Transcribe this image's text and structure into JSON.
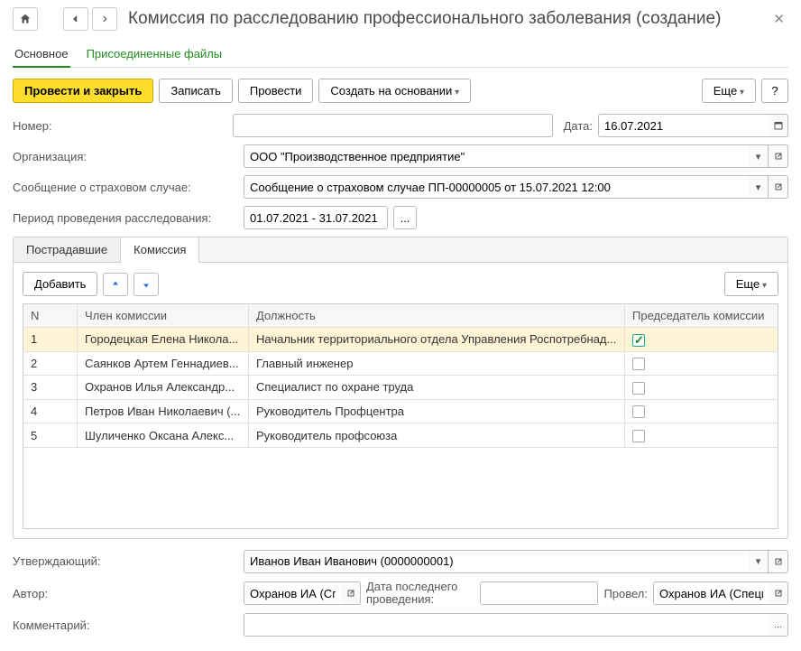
{
  "header": {
    "title": "Комиссия по расследованию профессионального заболевания (создание)"
  },
  "nav_tabs": {
    "main": "Основное",
    "attached": "Присоединенные файлы"
  },
  "toolbar": {
    "post_close": "Провести и закрыть",
    "save": "Записать",
    "post": "Провести",
    "create_based": "Создать на основании",
    "more": "Еще",
    "help": "?"
  },
  "fields": {
    "number_label": "Номер:",
    "number_value": "",
    "date_label": "Дата:",
    "date_value": "16.07.2021",
    "org_label": "Организация:",
    "org_value": "ООО \"Производственное предприятие\"",
    "case_label": "Сообщение о страховом случае:",
    "case_value": "Сообщение о страховом случае ПП-00000005 от 15.07.2021 12:00",
    "period_label": "Период проведения расследования:",
    "period_value": "01.07.2021 - 31.07.2021"
  },
  "panel": {
    "tab_victims": "Пострадавшие",
    "tab_commission": "Комиссия",
    "add": "Добавить",
    "more": "Еще",
    "col_n": "N",
    "col_member": "Член комиссии",
    "col_position": "Должность",
    "col_chair": "Председатель комиссии",
    "rows": [
      {
        "n": "1",
        "member": "Городецкая Елена Никола...",
        "position": "Начальник территориального отдела Управления Роспотребнад...",
        "chair": true
      },
      {
        "n": "2",
        "member": "Саянков Артем Геннадиев...",
        "position": "Главный инженер",
        "chair": false
      },
      {
        "n": "3",
        "member": "Охранов Илья Александр...",
        "position": "Специалист по охране труда",
        "chair": false
      },
      {
        "n": "4",
        "member": "Петров Иван Николаевич (...",
        "position": "Руководитель Профцентра",
        "chair": false
      },
      {
        "n": "5",
        "member": "Шуличенко Оксана Алекс...",
        "position": "Руководитель профсоюза",
        "chair": false
      }
    ]
  },
  "footer": {
    "approver_label": "Утверждающий:",
    "approver_value": "Иванов Иван Иванович (0000000001)",
    "author_label": "Автор:",
    "author_value": "Охранов ИА (Специ",
    "lastpost_label": "Дата последнего проведения:",
    "lastpost_value": "",
    "poster_label": "Провел:",
    "poster_value": "Охранов ИА (Специ",
    "comment_label": "Комментарий:",
    "comment_value": ""
  }
}
